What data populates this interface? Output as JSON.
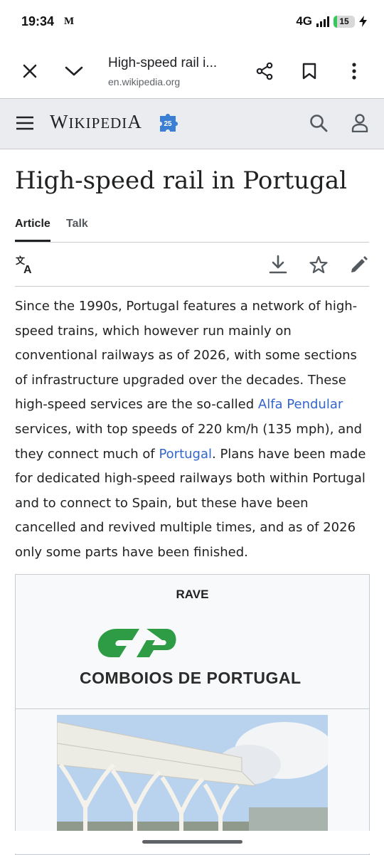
{
  "status_bar": {
    "time": "19:34",
    "notification_icon": "news-app-icon",
    "notification_text": "M",
    "network": "4G",
    "battery_level": "15",
    "battery_fraction": 0.15
  },
  "browser": {
    "title": "High-speed rail i...",
    "url": "en.wikipedia.org",
    "icons": [
      "close-icon",
      "chevron-down-icon",
      "share-icon",
      "bookmark-icon",
      "more-vert-icon"
    ]
  },
  "wiki_header": {
    "wordmark_first": "W",
    "wordmark_rest": "IKIPEDI",
    "wordmark_last": "A",
    "badge_text": "25",
    "icons": [
      "menu-icon",
      "search-icon",
      "user-icon"
    ]
  },
  "article": {
    "title": "High-speed rail in Portugal",
    "tabs": [
      {
        "label": "Article",
        "active": true
      },
      {
        "label": "Talk",
        "active": false
      }
    ],
    "action_icons": [
      "language-icon",
      "download-icon",
      "star-icon",
      "edit-icon"
    ],
    "paragraph": {
      "part1": "Since the 1990s, Portugal features a network of high-speed trains, which however run mainly on conventional railways as of 2026, with some sections of infrastructure upgraded over the decades. These high-speed services are the so-called ",
      "link1": "Alfa Pendular",
      "part2": " services, with top speeds of 220 km/h (135 mph), and they connect much of ",
      "link2": "Portugal",
      "part3": ". Plans have been made for dedicated high-speed railways both within Portugal and to connect to Spain, but these have been cancelled and revived multiple times, and as of 2026 only some parts have been finished."
    }
  },
  "infobox": {
    "title": "RAVE",
    "logo_text": "COMBOIOS DE PORTUGAL",
    "logo_color": "#2e9b45",
    "image": "station-roof-photo"
  },
  "colors": {
    "link": "#3366cc",
    "header_bg": "#eaecf0",
    "border": "#c8ccd1"
  }
}
